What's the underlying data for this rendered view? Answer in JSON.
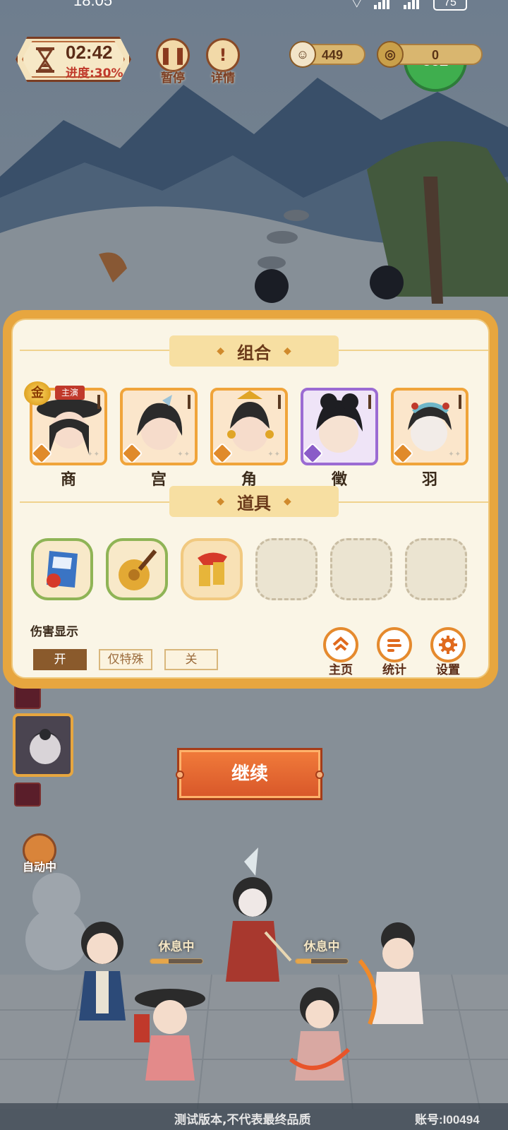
{
  "status_bar": {
    "time": "18:05",
    "battery": "75"
  },
  "hud": {
    "timer": "02:42",
    "progress": "进度:30%",
    "pause_label": "暂停",
    "detail_label": "详情",
    "currency_1": "449",
    "currency_2": "0",
    "badge_value": "882"
  },
  "dialog": {
    "combo_title": "组合",
    "heroes": [
      {
        "name": "商",
        "badge": "金",
        "tag": "主演"
      },
      {
        "name": "宫"
      },
      {
        "name": "角"
      },
      {
        "name": "徵"
      },
      {
        "name": "羽"
      }
    ],
    "items_title": "道具",
    "damage_label": "伤害显示",
    "damage_options": [
      "开",
      "仅特殊",
      "关"
    ],
    "damage_selected": "开",
    "menu": {
      "home": "主页",
      "stats": "统计",
      "settings": "设置"
    }
  },
  "continue_label": "继续",
  "auto_label": "自动中",
  "rest_labels": [
    "休息中",
    "休息中"
  ],
  "rest_progress": [
    0.35,
    0.3
  ],
  "footer": {
    "notice": "测试版本,不代表最终品质",
    "account": "账号:I00494"
  },
  "colors": {
    "dialog_border": "#e7a63f",
    "dialog_bg": "#faf5e6",
    "accent_orange": "#e58a2e",
    "continue_bg": "#d9582a"
  }
}
